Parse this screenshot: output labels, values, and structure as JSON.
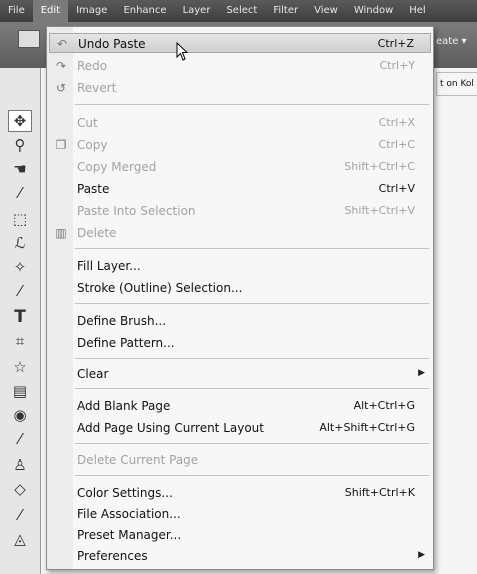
{
  "menubar": {
    "items": [
      "File",
      "Edit",
      "Image",
      "Enhance",
      "Layer",
      "Select",
      "Filter",
      "View",
      "Window",
      "Hel"
    ]
  },
  "toolbar": {
    "create_label": "eate ▾"
  },
  "tip": {
    "text": "t on Kol"
  },
  "edit_menu": {
    "items": [
      {
        "label": "Undo Paste",
        "shortcut": "Ctrl+Z",
        "disabled": false,
        "icon": "undo-icon"
      },
      {
        "label": "Redo",
        "shortcut": "Ctrl+Y",
        "disabled": true,
        "icon": "redo-icon"
      },
      {
        "label": "Revert",
        "shortcut": "",
        "disabled": true,
        "icon": "revert-icon"
      },
      {
        "label": "Cut",
        "shortcut": "Ctrl+X",
        "disabled": true
      },
      {
        "label": "Copy",
        "shortcut": "Ctrl+C",
        "disabled": true,
        "icon": "copy-icon"
      },
      {
        "label": "Copy Merged",
        "shortcut": "Shift+Ctrl+C",
        "disabled": true
      },
      {
        "label": "Paste",
        "shortcut": "Ctrl+V",
        "disabled": false
      },
      {
        "label": "Paste Into Selection",
        "shortcut": "Shift+Ctrl+V",
        "disabled": true
      },
      {
        "label": "Delete",
        "shortcut": "",
        "disabled": true,
        "icon": "trash-icon"
      },
      {
        "label": "Fill Layer...",
        "shortcut": "",
        "disabled": false
      },
      {
        "label": "Stroke (Outline) Selection...",
        "shortcut": "",
        "disabled": false
      },
      {
        "label": "Define Brush...",
        "shortcut": "",
        "disabled": false
      },
      {
        "label": "Define Pattern...",
        "shortcut": "",
        "disabled": false
      },
      {
        "label": "Clear",
        "shortcut": "",
        "disabled": false,
        "submenu": true
      },
      {
        "label": "Add Blank Page",
        "shortcut": "Alt+Ctrl+G",
        "disabled": false
      },
      {
        "label": "Add Page Using Current Layout",
        "shortcut": "Alt+Shift+Ctrl+G",
        "disabled": false
      },
      {
        "label": "Delete Current Page",
        "shortcut": "",
        "disabled": true
      },
      {
        "label": "Color Settings...",
        "shortcut": "Shift+Ctrl+K",
        "disabled": false
      },
      {
        "label": "File Association...",
        "shortcut": "",
        "disabled": false
      },
      {
        "label": "Preset Manager...",
        "shortcut": "",
        "disabled": false
      },
      {
        "label": "Preferences",
        "shortcut": "",
        "disabled": false,
        "submenu": true
      }
    ]
  },
  "toolbox": {
    "tools": [
      "move-tool-icon",
      "zoom-tool-icon",
      "hand-tool-icon",
      "eyedropper-tool-icon",
      "marquee-tool-icon",
      "lasso-tool-icon",
      "magic-wand-tool-icon",
      "brush-tool-icon",
      "type-tool-icon",
      "crop-tool-icon",
      "shape-tool-icon",
      "stamp-tool-icon",
      "red-eye-tool-icon",
      "healing-tool-icon",
      "clone-tool-icon",
      "eraser-tool-icon",
      "pencil-tool-icon",
      "blur-tool-icon"
    ]
  }
}
